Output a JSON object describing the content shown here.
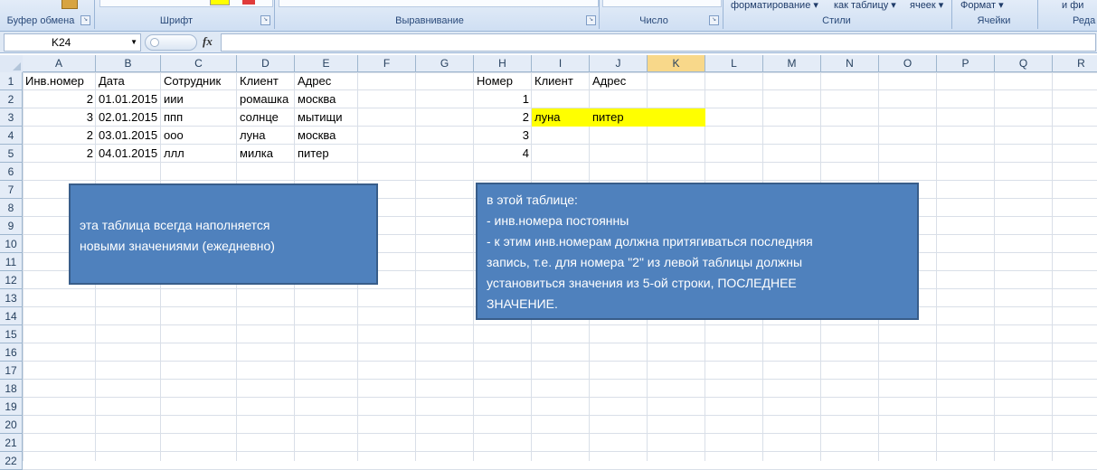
{
  "ribbon": {
    "groups": [
      {
        "label": "Буфер обмена"
      },
      {
        "label": "Шрифт"
      },
      {
        "label": "Выравнивание"
      },
      {
        "label": "Число"
      },
      {
        "label": "Стили"
      },
      {
        "label": "Ячейки"
      },
      {
        "label": "Реда"
      }
    ],
    "top_items": {
      "format_cond": "форматирование ▾",
      "as_table": "как таблицу ▾",
      "cells_style": "ячеек ▾",
      "format": "Формат ▾",
      "fill": "и фи"
    }
  },
  "formula_bar": {
    "name_box": "K24",
    "fx_label": "fx",
    "formula": ""
  },
  "columns": [
    "A",
    "B",
    "C",
    "D",
    "E",
    "F",
    "G",
    "H",
    "I",
    "J",
    "K",
    "L",
    "M",
    "N",
    "O",
    "P",
    "Q",
    "R"
  ],
  "active_column": "K",
  "rows": [
    "1",
    "2",
    "3",
    "4",
    "5",
    "6",
    "7",
    "8",
    "9",
    "10",
    "11",
    "12",
    "13",
    "14",
    "15",
    "16",
    "17",
    "18",
    "19",
    "20",
    "21",
    "22"
  ],
  "left_table": {
    "headers": [
      "Инв.номер",
      "Дата",
      "Сотрудник",
      "Клиент",
      "Адрес"
    ],
    "rows": [
      [
        "2",
        "01.01.2015",
        "иии",
        "ромашка",
        "москва"
      ],
      [
        "3",
        "02.01.2015",
        "ппп",
        "солнце",
        "мытищи"
      ],
      [
        "2",
        "03.01.2015",
        "ооо",
        "луна",
        "москва"
      ],
      [
        "2",
        "04.01.2015",
        "ллл",
        "милка",
        "питер"
      ]
    ]
  },
  "right_table": {
    "headers": [
      "Номер",
      "Клиент",
      "Адрес"
    ],
    "rows": [
      [
        "1",
        "",
        ""
      ],
      [
        "2",
        "луна",
        "питер"
      ],
      [
        "3",
        "",
        ""
      ],
      [
        "4",
        "",
        ""
      ]
    ],
    "highlight_color": "#ffff00"
  },
  "notes": {
    "left": [
      "эта таблица всегда наполняется",
      "новыми значениями (ежедневно)"
    ],
    "right": [
      "в этой таблице:",
      "- инв.номера постоянны",
      "- к этим инв.номерам должна притягиваться последняя",
      "запись, т.е. для номера \"2\" из левой таблицы должны",
      "установиться значения из 5-ой строки, ПОСЛЕДНЕЕ",
      "ЗНАЧЕНИЕ."
    ],
    "fill_color": "#4f81bd"
  }
}
